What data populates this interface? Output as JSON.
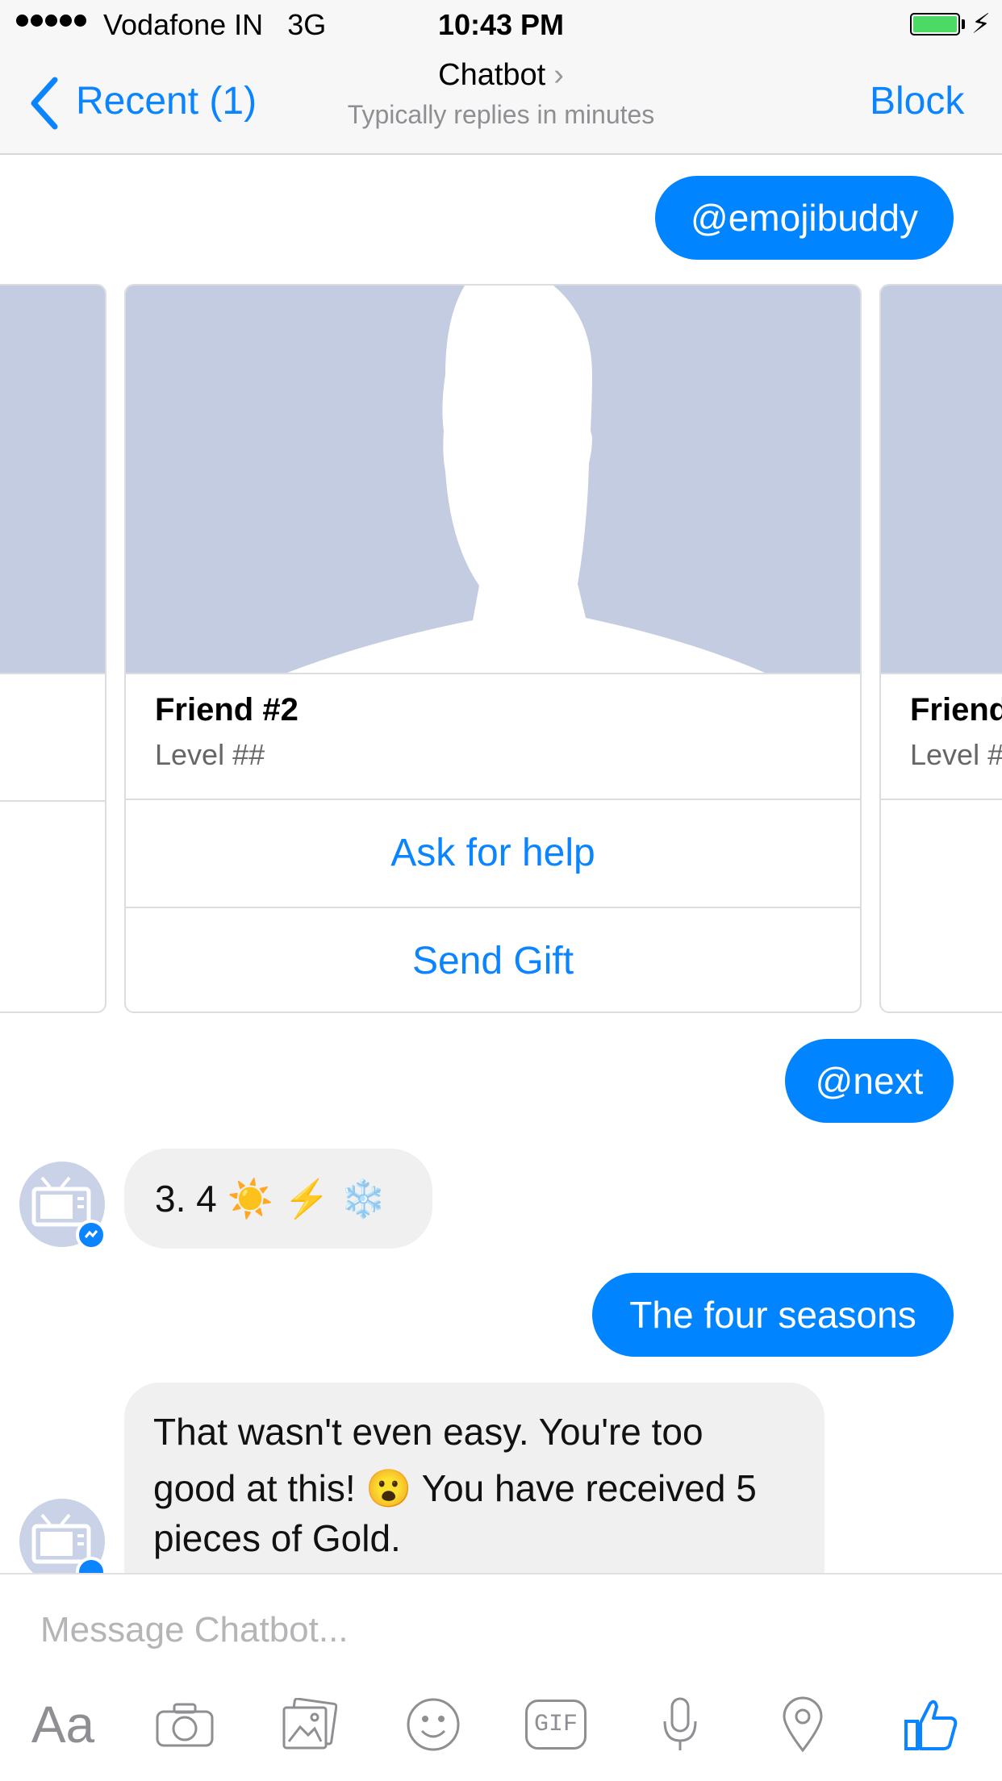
{
  "status_bar": {
    "carrier": "Vodafone IN",
    "network": "3G",
    "time": "10:43 PM"
  },
  "nav": {
    "back_label": "Recent (1)",
    "title": "Chatbot",
    "subtitle": "Typically replies in minutes",
    "block_label": "Block"
  },
  "messages": {
    "out1": "@emojibuddy",
    "carousel": {
      "center_card": {
        "title": "Friend #2",
        "subtitle": "Level ##",
        "button1": "Ask for help",
        "button2": "Send Gift"
      },
      "right_card": {
        "title": "Friend",
        "subtitle": "Level #"
      }
    },
    "out2": "@next",
    "in1": "3. 4 ☀️ ⚡ ❄️",
    "out3": "The four seasons",
    "in2_line1": "That wasn't even easy. You're too",
    "in2_line2": "good at this! 😮 You have received 5",
    "in2_line3": "pieces of Gold."
  },
  "composer": {
    "placeholder": "Message Chatbot...",
    "tools": [
      "text-format-icon",
      "camera-icon",
      "gallery-icon",
      "emoji-icon",
      "gif-icon",
      "microphone-icon",
      "location-icon",
      "like-icon"
    ],
    "text_tool_label": "Aa",
    "gif_label": "GIF"
  },
  "colors": {
    "accent": "#0a84ff",
    "outgoing_bubble": "#0084ff",
    "incoming_bubble": "#f1f0f0",
    "card_image": "#c3cce0"
  }
}
